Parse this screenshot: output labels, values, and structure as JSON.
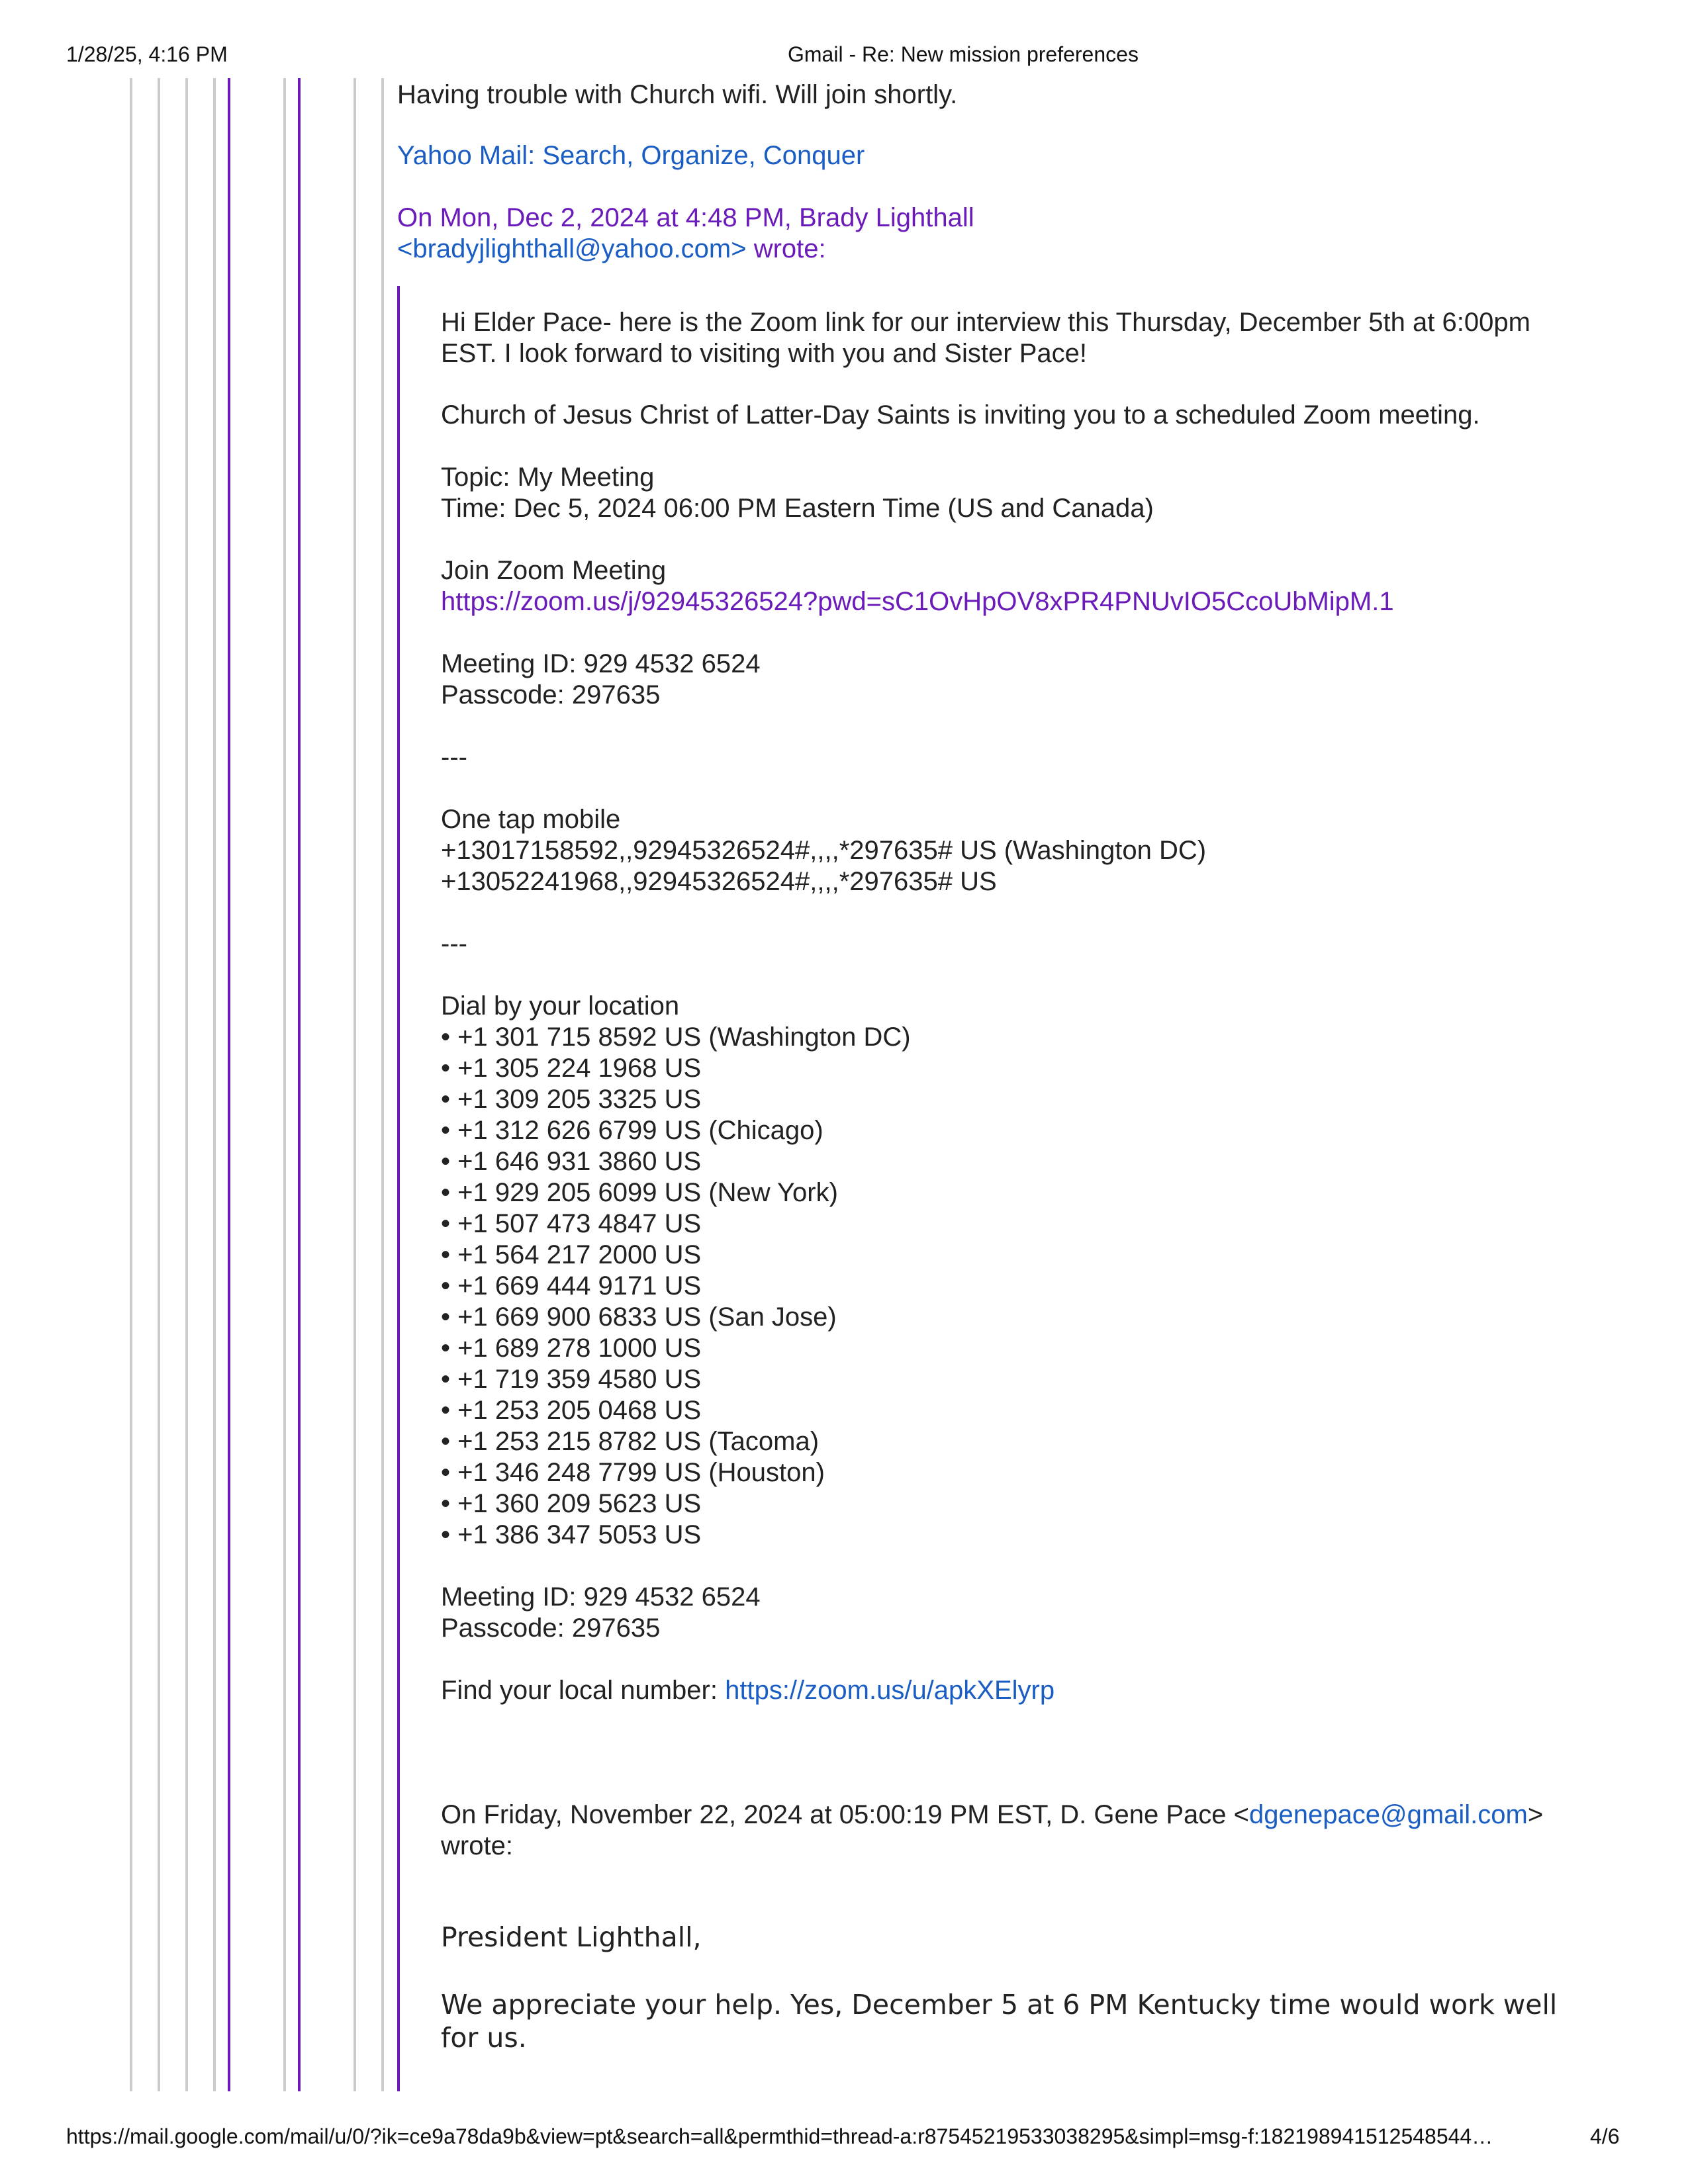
{
  "print_header": {
    "datetime": "1/28/25, 4:16 PM",
    "title": "Gmail - Re: New mission preferences"
  },
  "print_footer": {
    "url": "https://mail.google.com/mail/u/0/?ik=ce9a78da9b&view=pt&search=all&permthid=thread-a:r87545219533038295&simpl=msg-f:182198941512548544…",
    "page": "4/6"
  },
  "reply": {
    "text": "Having trouble with Church wifi.  Will join shortly.",
    "signature_link": "Yahoo Mail: Search, Organize, Conquer",
    "attribution_line1": "On Mon, Dec 2, 2024 at 4:48 PM, Brady Lighthall",
    "attribution_email": "<bradyjlighthall@yahoo.com>",
    "attribution_wrote": " wrote:"
  },
  "quoted_message": {
    "greeting_line1": "Hi Elder Pace-  here is the Zoom link for our interview this Thursday, December 5th at 6:00pm",
    "greeting_line2": "EST.  I look forward to visiting with you and Sister Pace!",
    "invite": "Church of Jesus Christ of Latter-Day Saints is inviting you to a scheduled Zoom meeting.",
    "topic": "Topic: My Meeting",
    "time": "Time: Dec 5, 2024 06:00 PM Eastern Time (US and Canada)",
    "join_label": "Join Zoom Meeting",
    "join_link": "https://zoom.us/j/92945326524?pwd=sC1OvHpOV8xPR4PNUvIO5CcoUbMipM.1",
    "meeting_id": "Meeting ID: 929 4532 6524",
    "passcode": "Passcode: 297635",
    "separator": "---",
    "one_tap_label": "One tap mobile",
    "one_tap_numbers": [
      "+13017158592,,92945326524#,,,,*297635# US (Washington DC)",
      "+13052241968,,92945326524#,,,,*297635# US"
    ],
    "dial_label": "Dial by your location",
    "dial_numbers": [
      "• +1 301 715 8592 US (Washington DC)",
      "• +1 305 224 1968 US",
      "• +1 309 205 3325 US",
      "• +1 312 626 6799 US (Chicago)",
      "• +1 646 931 3860 US",
      "• +1 929 205 6099 US (New York)",
      "• +1 507 473 4847 US",
      "• +1 564 217 2000 US",
      "• +1 669 444 9171 US",
      "• +1 669 900 6833 US (San Jose)",
      "• +1 689 278 1000 US",
      "• +1 719 359 4580 US",
      "• +1 253 205 0468 US",
      "• +1 253 215 8782 US (Tacoma)",
      "• +1 346 248 7799 US (Houston)",
      "• +1 360 209 5623 US",
      "• +1 386 347 5053 US"
    ],
    "local_number_label": "Find your local number: ",
    "local_number_link": "https://zoom.us/u/apkXElyrp",
    "nested_attribution_prefix": "On Friday, November 22, 2024 at 05:00:19 PM EST, D. Gene Pace <",
    "nested_attribution_email": "dgenepace@gmail.com",
    "nested_attribution_suffix": ">",
    "nested_attribution_wrote": "wrote:"
  },
  "nested_message": {
    "salutation": "President Lighthall,",
    "body": "We appreciate your help. Yes, December 5 at 6 PM Kentucky time would work well for us."
  },
  "colors": {
    "link_blue": "#1a5ec4",
    "link_purple": "#6a1bb9",
    "quote_line_gray": "#cccccc",
    "quote_line_purple": "#6a1bb9"
  }
}
